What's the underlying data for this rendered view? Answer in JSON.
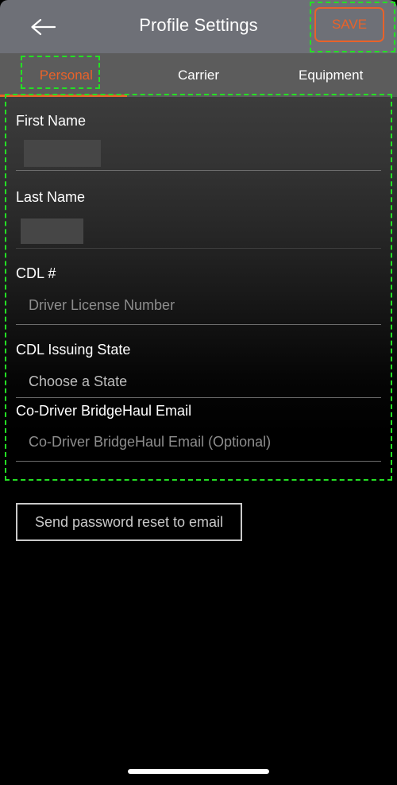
{
  "navbar": {
    "back_icon": "back-arrow-icon",
    "title": "Profile Settings",
    "save_label": "SAVE"
  },
  "tabs": [
    {
      "label": "Personal",
      "active": true
    },
    {
      "label": "Carrier",
      "active": false
    },
    {
      "label": "Equipment",
      "active": false
    }
  ],
  "form": {
    "fields": [
      {
        "label": "First Name",
        "value": "",
        "redacted": true
      },
      {
        "label": "Last Name",
        "value": "",
        "redacted": true
      },
      {
        "label": "CDL #",
        "placeholder": "Driver License Number"
      },
      {
        "label": "CDL Issuing State",
        "placeholder": "Choose a State"
      },
      {
        "label": "Co-Driver BridgeHaul Email",
        "placeholder": "Co-Driver BridgeHaul Email (Optional)"
      }
    ]
  },
  "actions": {
    "reset_password_label": "Send password reset to email"
  },
  "colors": {
    "accent": "#e8622a",
    "navbar_bg": "#6e7077",
    "tabbar_bg": "#5c5c5c",
    "label_text": "#ffffff",
    "placeholder_text": "#8d8d8d",
    "picker_text": "#bdbdbd",
    "annotation": "#24e024"
  }
}
